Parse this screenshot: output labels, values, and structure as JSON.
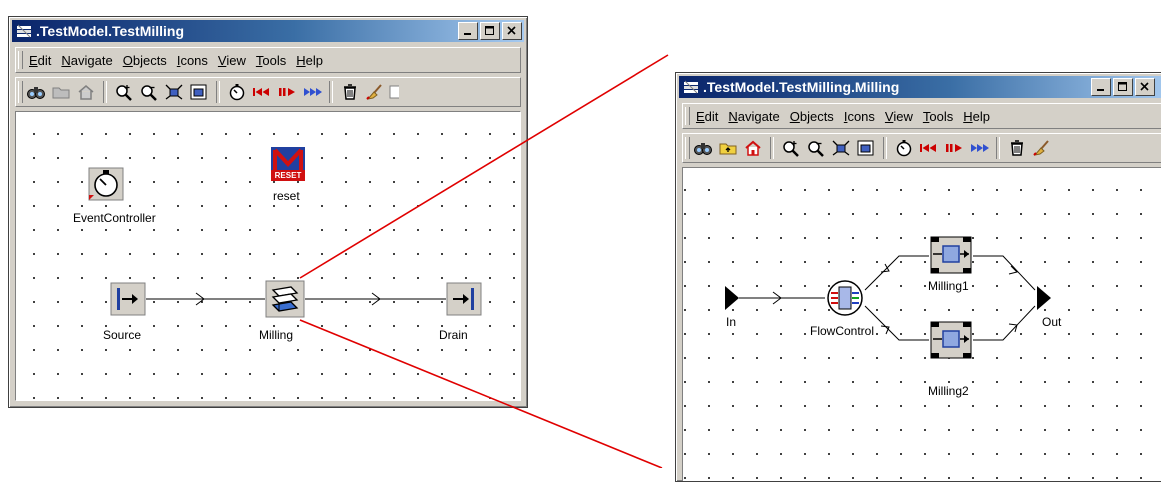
{
  "window_main": {
    "title": ".TestModel.TestMilling",
    "menu": [
      "Edit",
      "Navigate",
      "Objects",
      "Icons",
      "View",
      "Tools",
      "Help"
    ],
    "toolbar_icons": [
      "binoculars-icon",
      "folder-icon",
      "home-icon",
      "zoom-in-icon",
      "zoom-out-icon",
      "fit-icon",
      "overview-icon",
      "stopwatch-icon",
      "rewind-icon",
      "step-icon",
      "fast-forward-icon",
      "delete-icon",
      "broom-icon"
    ],
    "nodes": {
      "event_controller": "EventController",
      "reset": "reset",
      "reset_badge": "RESET",
      "source": "Source",
      "milling": "Milling",
      "drain": "Drain"
    }
  },
  "window_detail": {
    "title": ".TestModel.TestMilling.Milling",
    "menu": [
      "Edit",
      "Navigate",
      "Objects",
      "Icons",
      "View",
      "Tools",
      "Help"
    ],
    "toolbar_icons": [
      "binoculars-icon",
      "folder-up-icon",
      "home-icon",
      "zoom-in-icon",
      "zoom-out-icon",
      "fit-icon",
      "overview-icon",
      "stopwatch-icon",
      "rewind-icon",
      "step-icon",
      "fast-forward-icon",
      "delete-icon",
      "broom-icon"
    ],
    "nodes": {
      "in": "In",
      "flow_control": "FlowControl",
      "milling1": "Milling1",
      "milling2": "Milling2",
      "out": "Out"
    }
  },
  "colors": {
    "title_start": "#0a246a",
    "title_end": "#a6caf0",
    "zoom_line": "#e00000",
    "reset_red": "#d01010",
    "node_blue": "#2040a0"
  }
}
